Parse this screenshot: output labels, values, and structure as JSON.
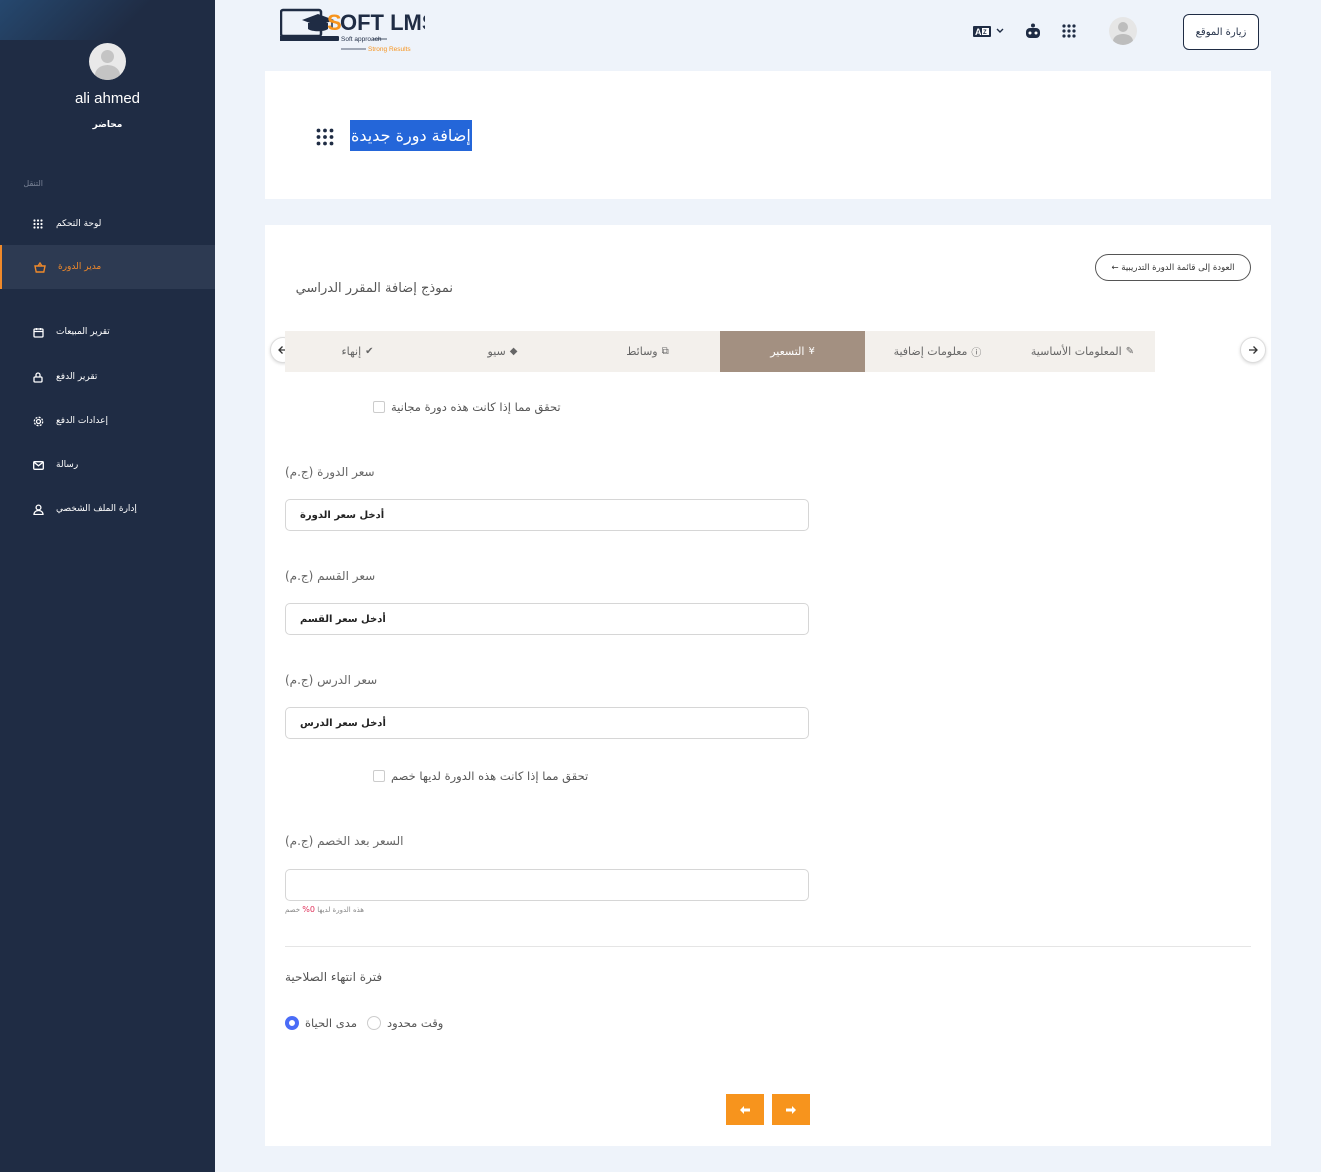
{
  "sidebar": {
    "user_name": "ali ahmed",
    "user_role": "محاضر",
    "section_label": "التنقل",
    "items": [
      {
        "label": "لوحة التحكم",
        "icon": "grid-icon",
        "active": false
      },
      {
        "label": "مدير الدورة",
        "icon": "basket-icon",
        "active": true
      },
      {
        "label": "تقرير المبيعات",
        "icon": "calendar-icon",
        "active": false
      },
      {
        "label": "تقرير الدفع",
        "icon": "lock-icon",
        "active": false
      },
      {
        "label": "إعدادات الدفع",
        "icon": "gear-icon",
        "active": false
      },
      {
        "label": "رسالة",
        "icon": "mail-icon",
        "active": false
      },
      {
        "label": "إدارة الملف الشخصي",
        "icon": "user-icon",
        "active": false
      }
    ]
  },
  "header": {
    "logo_text": "SOFT LMS",
    "logo_tagline_1": "Soft approach",
    "logo_tagline_2": "Strong Results",
    "visit_site": "زيارة الموقع"
  },
  "page_title": "إضافة دورة جديدة",
  "form": {
    "back_button": "العودة إلى قائمة الدورة التدريبية ←",
    "title": "نموذج إضافة المقرر الدراسي",
    "tabs": [
      {
        "label": "المعلومات الأساسية",
        "icon": "pencil-icon"
      },
      {
        "label": "معلومات إضافية",
        "icon": "info-icon"
      },
      {
        "label": "التسعير",
        "icon": "yen-icon",
        "active": true
      },
      {
        "label": "وسائط",
        "icon": "media-icon"
      },
      {
        "label": "سيو",
        "icon": "tag-icon"
      },
      {
        "label": "إنهاء",
        "icon": "check-circle-icon"
      }
    ],
    "free_check_label": "تحقق مما إذا كانت هذه دورة مجانية",
    "course_price_label": "سعر الدورة (ج.م)",
    "course_price_value": "أدخل سعر الدورة",
    "section_price_label": "سعر القسم (ج.م)",
    "section_price_value": "أدخل سعر القسم",
    "lesson_price_label": "سعر الدرس (ج.م)",
    "lesson_price_value": "أدخل سعر الدرس",
    "discount_check_label": "تحقق مما إذا كانت هذه الدورة لديها خصم",
    "discounted_price_label": "السعر بعد الخصم (ج.م)",
    "discounted_price_value": "",
    "hint_prefix": "هذه الدورة لديها ",
    "hint_percent": "0%",
    "hint_suffix": " خصم",
    "expiry_label": "فترة انتهاء الصلاحية",
    "radio_lifetime": "مدى الحياة",
    "radio_limited": "وقت محدود",
    "selected_expiry": "lifetime"
  },
  "colors": {
    "sidebar_bg": "#1f2c44",
    "accent_orange": "#f7941d",
    "active_tab": "#a39081",
    "title_highlight": "#2466d9"
  }
}
